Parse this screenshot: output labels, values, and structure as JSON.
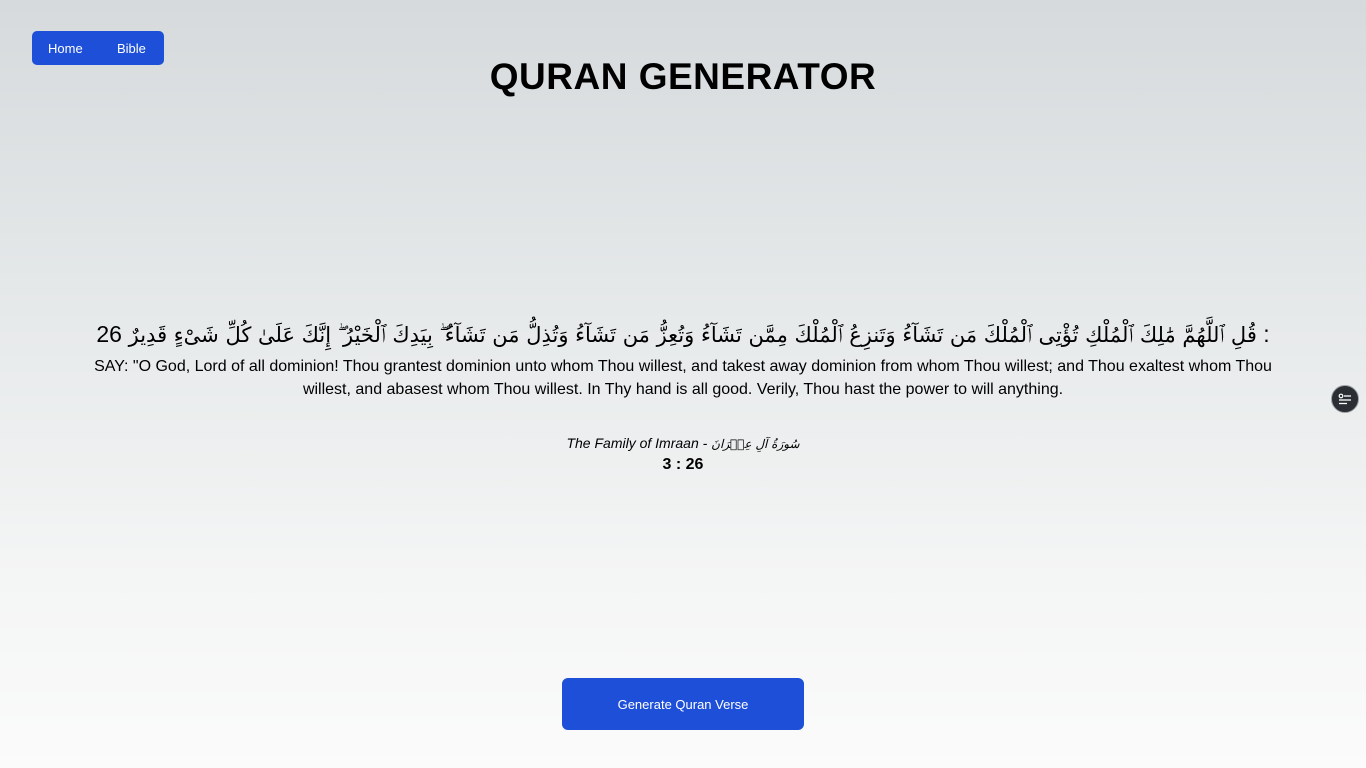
{
  "nav": {
    "home_label": "Home",
    "bible_label": "Bible"
  },
  "page_title": "QURAN GENERATOR",
  "verse": {
    "arabic": "قُلِ ٱللَّهُمَّ مَٰلِكَ ٱلْمُلْكِ تُؤْتِى ٱلْمُلْكَ مَن تَشَآءُ وَتَنزِعُ ٱلْمُلْكَ مِمَّن تَشَآءُ وَتُعِزُّ مَن تَشَآءُ وَتُذِلُّ مَن تَشَآءُ ۖ بِيَدِكَ ٱلْخَيْرُ ۖ إِنَّكَ عَلَىٰ كُلِّ شَىْءٍ قَدِيرٌ",
    "arabic_number": "26 :",
    "translation": "SAY: \"O God, Lord of all dominion! Thou grantest dominion unto whom Thou willest, and takest away dominion from whom Thou willest; and Thou exaltest whom Thou willest, and abasest whom Thou willest. In Thy hand is all good. Verily, Thou hast the power to will anything.",
    "surah_english": "The Family of Imraan - ",
    "surah_arabic": "سُورَةُ آلِ عِمۡرَانَ",
    "reference": "3 : 26"
  },
  "generate_button_label": "Generate Quran Verse",
  "icons": {
    "side_widget": "list-settings-icon"
  },
  "colors": {
    "accent": "#1d4fd8",
    "widget_bg": "#2b2f33"
  }
}
